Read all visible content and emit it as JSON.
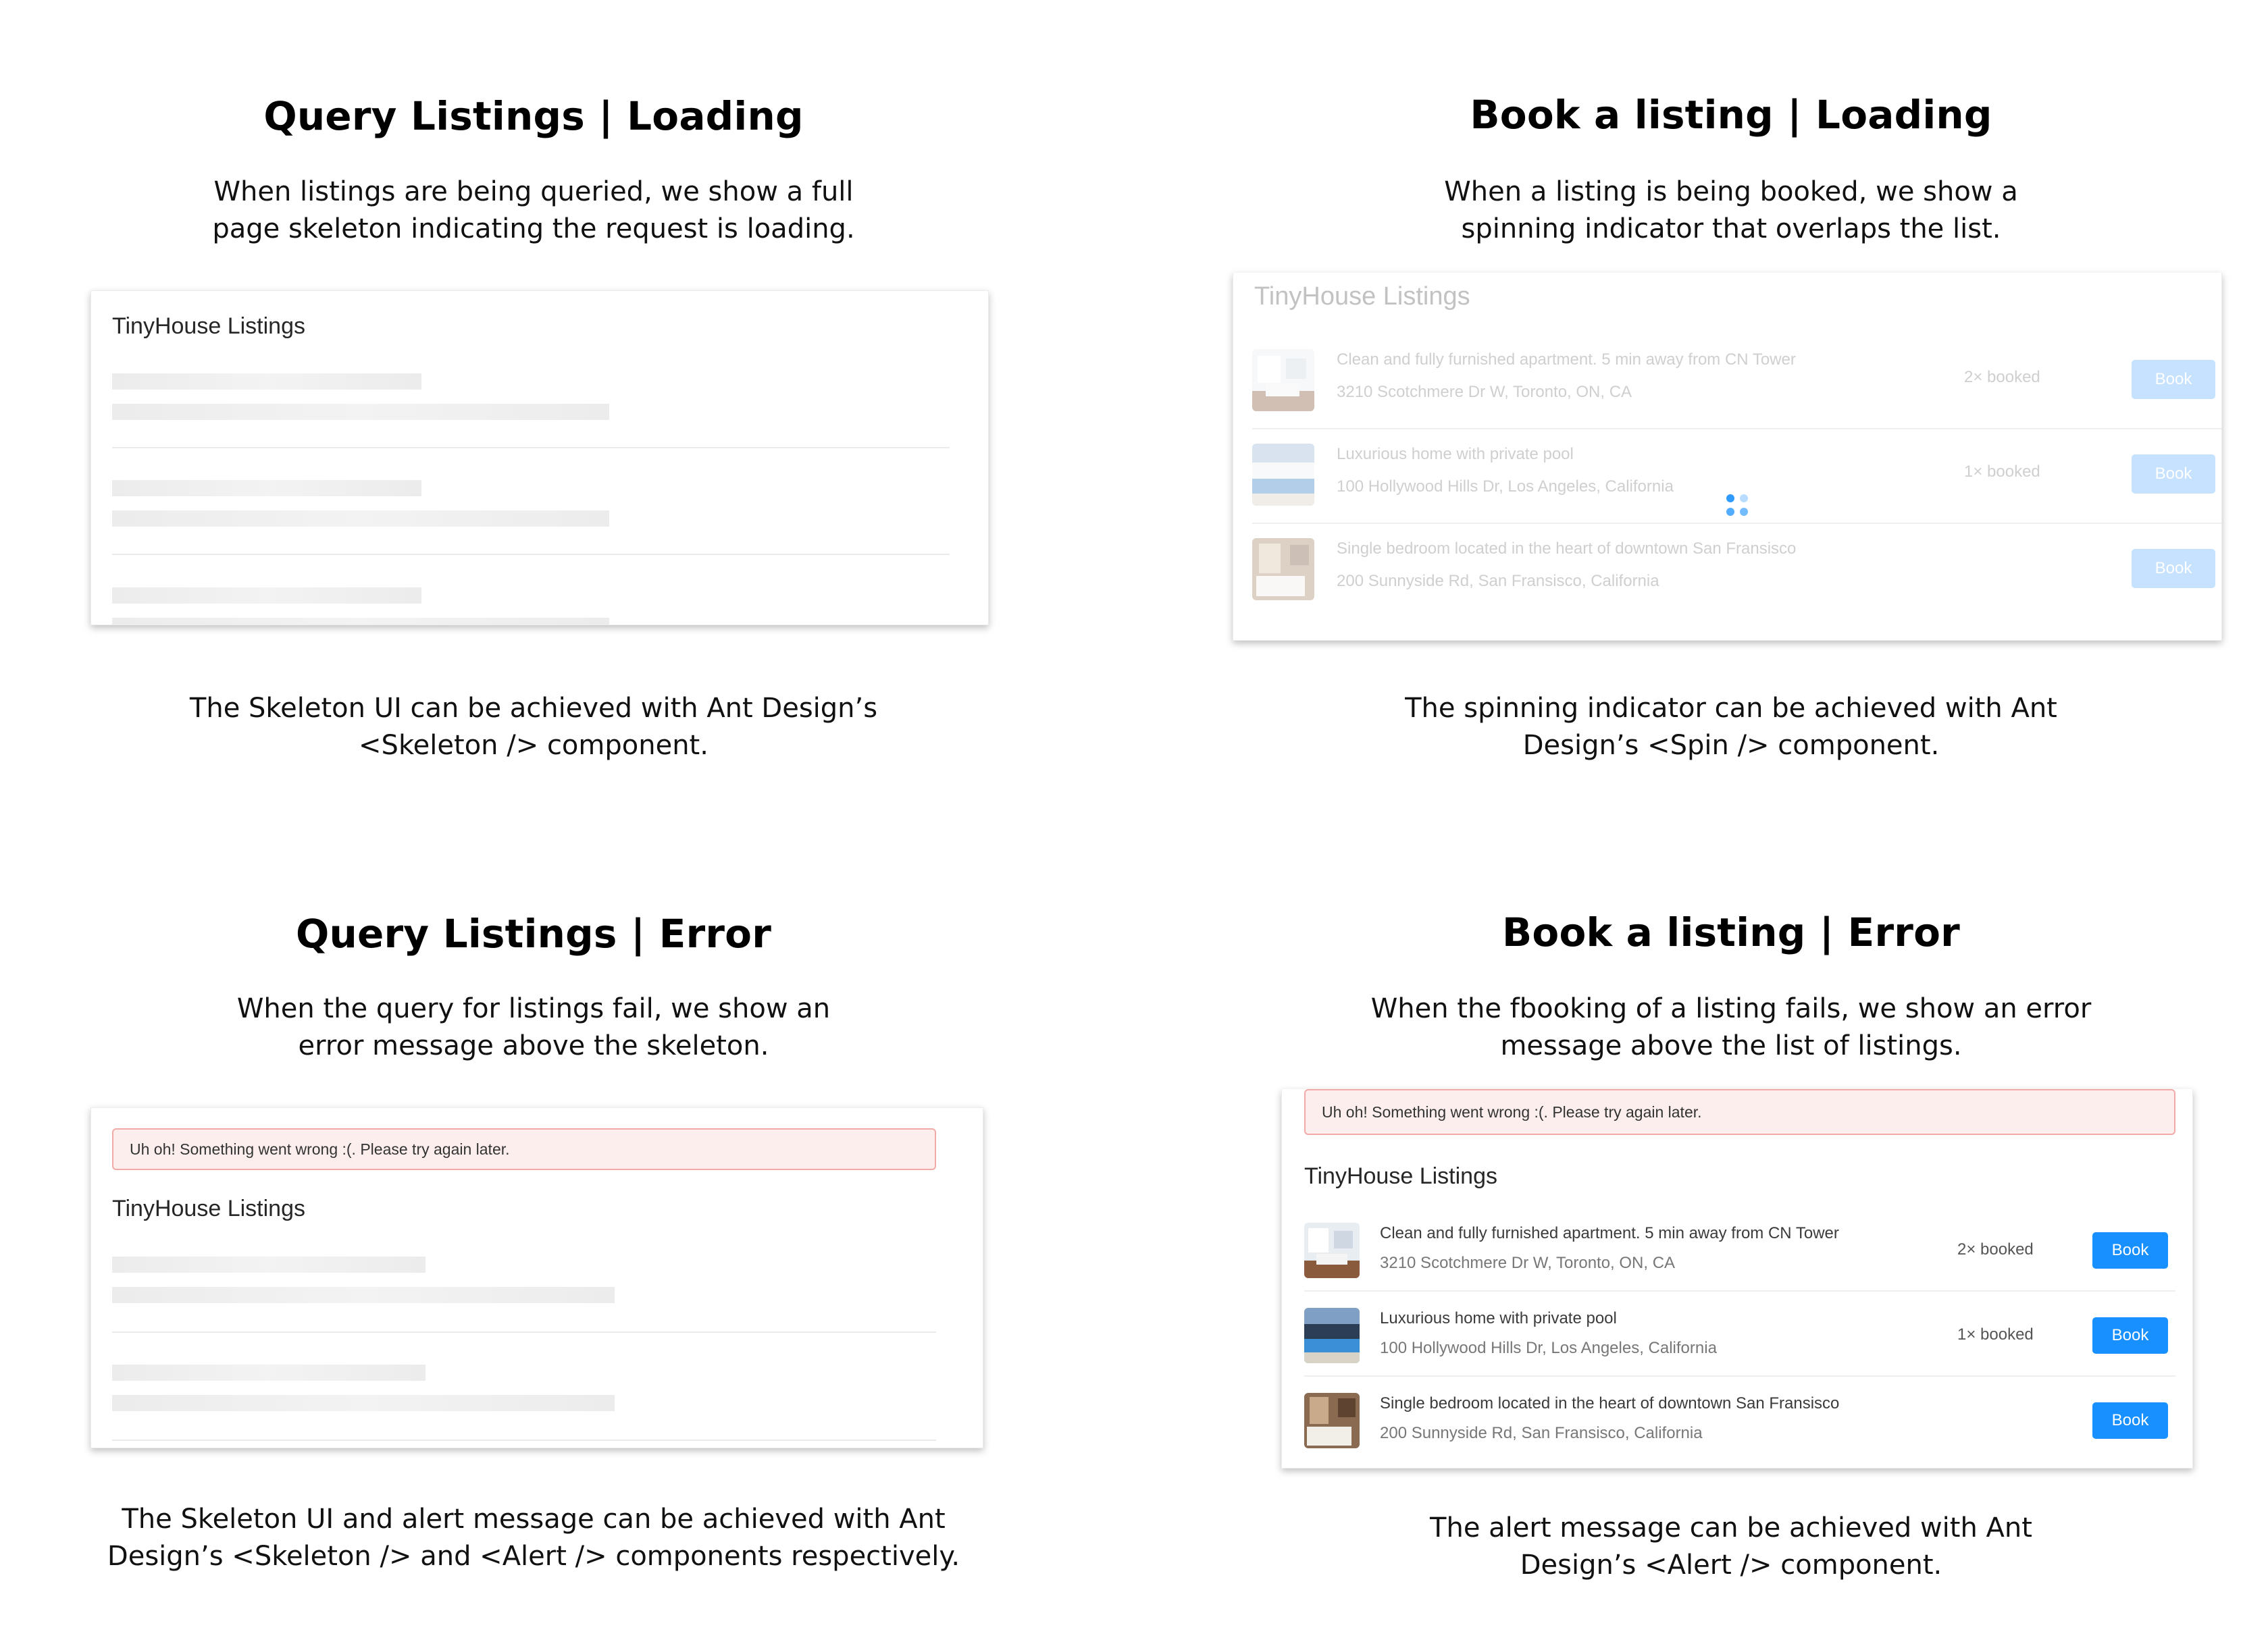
{
  "panels": {
    "query_loading": {
      "heading": "Query Listings | Loading",
      "desc_lines": [
        "When listings are being queried, we show a full",
        "page skeleton indicating the request is loading."
      ],
      "card_title": "TinyHouse Listings",
      "note_lines": [
        "The Skeleton UI can be achieved with Ant Design’s",
        "<Skeleton /> component."
      ]
    },
    "book_loading": {
      "heading": "Book a listing | Loading",
      "desc_lines": [
        "When a listing is being booked, we show a",
        "spinning indicator that overlaps the list."
      ],
      "card_title": "TinyHouse Listings",
      "note_lines": [
        "The spinning indicator can be achieved with Ant",
        "Design’s <Spin /> component."
      ]
    },
    "query_error": {
      "heading": "Query Listings | Error",
      "desc_lines": [
        "When the query for listings fail, we show an",
        "error message above the skeleton."
      ],
      "alert": "Uh oh! Something went wrong :(. Please try again later.",
      "card_title": "TinyHouse Listings",
      "note_lines": [
        "The Skeleton UI and alert message can be achieved with Ant",
        "Design’s <Skeleton /> and <Alert /> components respectively."
      ]
    },
    "book_error": {
      "heading": "Book a listing | Error",
      "desc_lines": [
        "When the fbooking of a listing fails, we show an error",
        "message above the list of listings."
      ],
      "alert": "Uh oh! Something went wrong :(. Please try again later.",
      "card_title": "TinyHouse Listings",
      "note_lines": [
        "The alert message can be achieved with Ant",
        "Design’s <Alert /> component."
      ]
    }
  },
  "listings": [
    {
      "title": "Clean and fully furnished apartment. 5 min away from CN Tower",
      "address": "3210 Scotchmere Dr W, Toronto, ON, CA",
      "bookings": "2× booked",
      "action": "Book",
      "thumb_icon": "apartment-photo"
    },
    {
      "title": "Luxurious home with private pool",
      "address": "100 Hollywood Hills Dr, Los Angeles, California",
      "bookings": "1× booked",
      "action": "Book",
      "thumb_icon": "pool-house-photo"
    },
    {
      "title": "Single bedroom located in the heart of downtown San Fransisco",
      "address": "200 Sunnyside Rd, San Fransisco, California",
      "bookings": "",
      "action": "Book",
      "thumb_icon": "bedroom-photo"
    }
  ],
  "colors": {
    "primary": "#1890ff",
    "alert_bg": "#fdeeee",
    "alert_border": "#f2aaa8"
  }
}
